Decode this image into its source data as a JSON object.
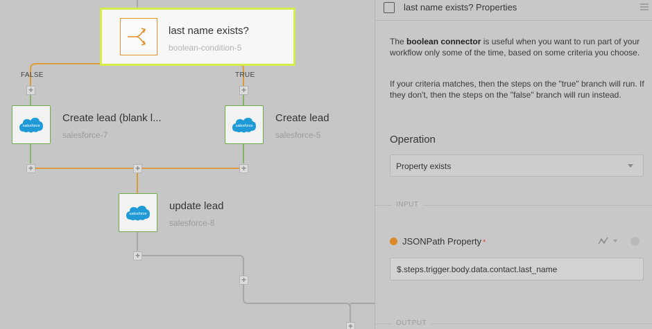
{
  "canvas": {
    "selected_node": {
      "title": "last name exists?",
      "subtitle": "boolean-condition-5"
    },
    "branch_false": "FALSE",
    "branch_true": "TRUE",
    "nodes": [
      {
        "title": "Create lead (blank l...",
        "subtitle": "salesforce-7"
      },
      {
        "title": "Create lead",
        "subtitle": "salesforce-5"
      },
      {
        "title": "update lead",
        "subtitle": "salesforce-8"
      }
    ],
    "logo_text": "salesforce",
    "plus": "+"
  },
  "panel": {
    "title": "last name exists? Properties",
    "desc1_pre": "The ",
    "desc1_bold": "boolean connector",
    "desc1_post": " is useful when you want to run part of your workflow only some of the time, based on some criteria you choose.",
    "desc2": "If your criteria matches, then the steps on the \"true\" branch will run. If they don't, then the steps on the \"false\" branch will run instead.",
    "operation_label": "Operation",
    "operation_value": "Property exists",
    "input_section": "INPUT",
    "output_section": "OUTPUT",
    "property_label": "JSONPath Property",
    "required_mark": "*",
    "property_value": "$.steps.trigger.body.data.contact.last_name"
  },
  "colors": {
    "accent_orange": "#e0912b",
    "node_green": "#6fa94c",
    "selection": "#d6ec4a",
    "salesforce_blue": "#1f9ad6"
  }
}
